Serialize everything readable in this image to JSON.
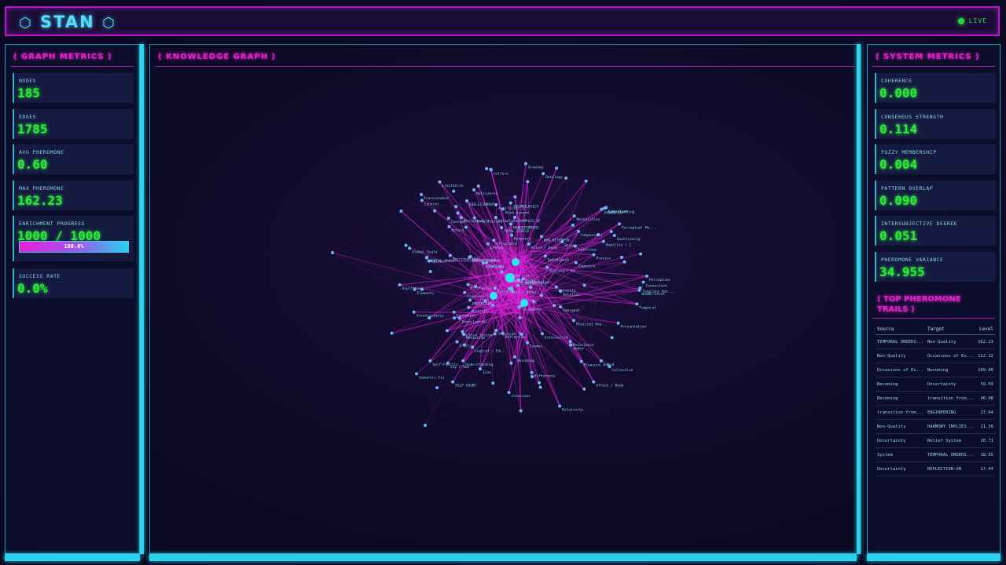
{
  "app": {
    "brand": "STAN",
    "status": "LIVE"
  },
  "left_panel": {
    "title": "( GRAPH METRICS )",
    "metrics": [
      {
        "label": "NODES",
        "value": "185"
      },
      {
        "label": "EDGES",
        "value": "1785"
      },
      {
        "label": "AVG PHEROMONE",
        "value": "0.60"
      },
      {
        "label": "MAX PHEROMONE",
        "value": "162.23"
      },
      {
        "label": "ENRICHMENT PROGRESS",
        "value": "1000 / 1000",
        "progress_label": "100.0%",
        "progress": 1.0
      },
      {
        "label": "SUCCESS RATE",
        "value": "0.0%"
      }
    ]
  },
  "center_panel": {
    "title": "( KNOWLEDGE GRAPH )"
  },
  "right_panel": {
    "title": "( SYSTEM METRICS )",
    "metrics": [
      {
        "label": "COHERENCE",
        "value": "0.000"
      },
      {
        "label": "CONSENSUS STRENGTH",
        "value": "0.114"
      },
      {
        "label": "FUZZY MEMBERSHIP",
        "value": "0.004"
      },
      {
        "label": "PATTERN OVERLAP",
        "value": "0.090"
      },
      {
        "label": "INTERSUBJECTIVE DEGREE",
        "value": "0.051"
      },
      {
        "label": "PHEROMONE VARIANCE",
        "value": "34.955"
      }
    ],
    "trails_title": "( TOP PHEROMONE TRAILS )",
    "trails_headers": [
      "Source",
      "Target",
      "Level"
    ],
    "trails": [
      [
        "TEMPORAL ORDERI...",
        "Non-Quality",
        "162.23"
      ],
      [
        "Non-Quality",
        "Occasions of Ex...",
        "122.12"
      ],
      [
        "Occasions of Ex...",
        "Becoming",
        "109.00"
      ],
      [
        "Becoming",
        "Uncertainty",
        "59.09"
      ],
      [
        "Becoming",
        "transition from...",
        "46.08"
      ],
      [
        "transition from...",
        "ENGINEERING",
        "27.64"
      ],
      [
        "Non-Quality",
        "HARMONY IMPLIES...",
        "21.38"
      ],
      [
        "Uncertainty",
        "Belief System",
        "20.71"
      ],
      [
        "System",
        "TEMPORAL ORDERI...",
        "18.55"
      ],
      [
        "Uncertainty",
        "REFLECTION-ON",
        "17.44"
      ]
    ]
  },
  "graph": {
    "node_labels": [
      "Template Pat...",
      "Physical Ta...",
      "Artificial I...",
      "SELF SAUNT",
      "TECHNOLOGICA",
      "EBELLISHMENT",
      "Alive / Dead",
      "Self-Functio...",
      "Computers as",
      "Intellective",
      "Questioning",
      "Index",
      "Humility / I",
      "Concept",
      "Perceptual Mo...",
      "Action System",
      "NON-DETERMIN...",
      "Externalist",
      "Evolution",
      "Process",
      "Culture",
      "Emergent",
      "Physics",
      "Abstract",
      "Combination",
      "Mediation",
      "Limitation",
      "Artificial L...",
      "Experiential",
      "Logic",
      "Understanding",
      "Belief System",
      "Conscious",
      "Mentalities",
      "Actors",
      "Aspiration",
      "Exposure",
      "Structural",
      "Spirituality",
      "Logical / Em...",
      "Ontology",
      "Sound",
      "Physical Hea...",
      "Property",
      "Activity",
      "Knowledge",
      "Inconsistency",
      "Affect / Body",
      "Understanding",
      "Cognition",
      "Recovery",
      "Relation",
      "Self / Other",
      "Pattern Web",
      "Mind Ground",
      "Ethics",
      "Embodiment",
      "Semantic Iss",
      "Resistance",
      "Human-Level",
      "Transcendent",
      "Temporal",
      "Relativity",
      "Global Scale",
      "Reflection",
      "Difference",
      "Presentation",
      "Multiverse",
      "Patterns",
      "Collective",
      "Pleasure / P",
      "Combinations",
      "Animation",
      "Connection",
      "CHAMPLES OF",
      "Conscious",
      "Being",
      "Becoming",
      "Compassion",
      "Joy / Awe",
      "TOTAL CIRCLE",
      "Stimulate",
      "Cosmos",
      "Perception",
      "Control",
      "Ecstasy / Ex",
      "Pattern",
      "Elements",
      "Growing",
      "Pleasure / P",
      "UNCERTAIN",
      "Perceptual A",
      "MENTAL SPACE",
      "NONDETERMINI",
      "SHARED STATE",
      "Icon"
    ]
  }
}
